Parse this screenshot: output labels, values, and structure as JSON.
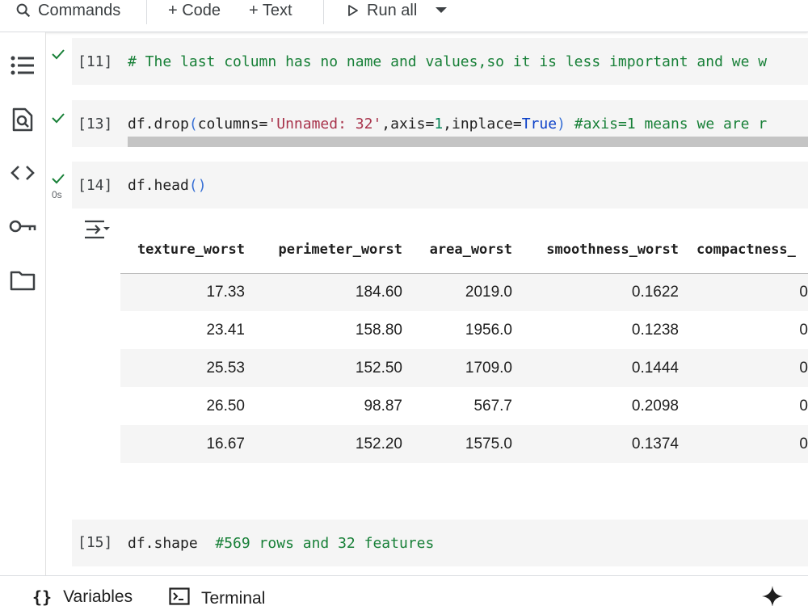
{
  "toolbar": {
    "commands_label": "Commands",
    "code_label": "+ Code",
    "text_label": "+ Text",
    "run_all_label": "Run all"
  },
  "sidebar": {
    "items": [
      "table-of-contents",
      "find-and-replace",
      "code-snippets",
      "secrets",
      "files"
    ]
  },
  "cells": [
    {
      "number": "[11]",
      "status": "success",
      "code": "# The last column has no name and values,so it is less important and we w"
    },
    {
      "number": "[13]",
      "status": "success",
      "code_parts": {
        "a": "df.drop",
        "b": "(",
        "c": "columns=",
        "d": "'Unnamed: 32'",
        "e": ",axis=",
        "f": "1",
        "g": ",inplace=",
        "h": "True",
        "i": ")",
        "j": " #axis=1 means we are r"
      }
    },
    {
      "number": "[14]",
      "status": "success",
      "exec_time": "0s",
      "code_parts": {
        "a": "df.head",
        "b": "()"
      }
    },
    {
      "number": "[15]",
      "code_parts": {
        "a": "df.shape",
        "b": "  #569 rows and 32 features"
      }
    }
  ],
  "output_table": {
    "columns": [
      "texture_worst",
      "perimeter_worst",
      "area_worst",
      "smoothness_worst",
      "compactness_"
    ],
    "rows": [
      [
        "17.33",
        "184.60",
        "2019.0",
        "0.1622",
        "0"
      ],
      [
        "23.41",
        "158.80",
        "1956.0",
        "0.1238",
        "0"
      ],
      [
        "25.53",
        "152.50",
        "1709.0",
        "0.1444",
        "0"
      ],
      [
        "26.50",
        "98.87",
        "567.7",
        "0.2098",
        "0"
      ],
      [
        "16.67",
        "152.20",
        "1575.0",
        "0.1374",
        "0"
      ]
    ]
  },
  "bottombar": {
    "variables_label": "Variables",
    "terminal_label": "Terminal"
  }
}
